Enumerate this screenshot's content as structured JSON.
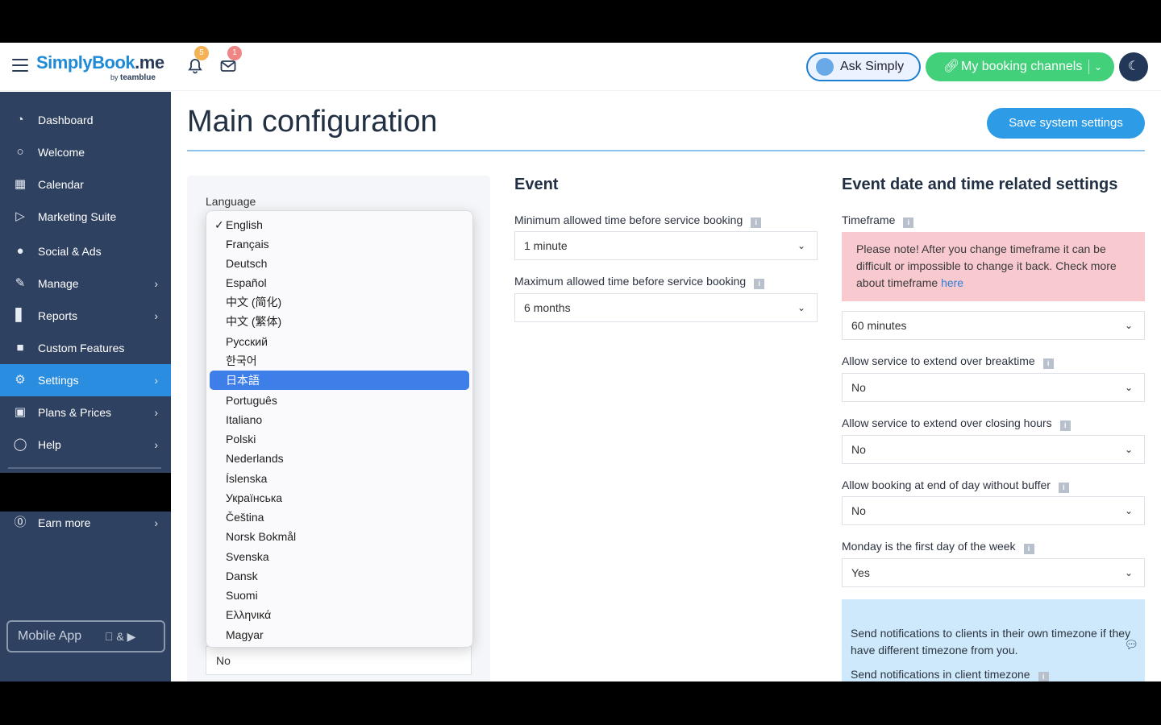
{
  "topbar": {
    "logo_main": "SimplyBook",
    "logo_suffix": ".me",
    "logo_by": "by",
    "logo_brand": "teamblue",
    "notif_count": "5",
    "mail_count": "1",
    "ask_label": "Ask Simply",
    "channels_label": "My booking channels"
  },
  "sidebar": {
    "items": [
      {
        "label": "Dashboard",
        "icon": "gauge-icon"
      },
      {
        "label": "Welcome",
        "icon": "lightbulb-icon"
      },
      {
        "label": "Calendar",
        "icon": "calendar-icon"
      },
      {
        "label": "Marketing Suite",
        "icon": "megaphone-icon"
      },
      {
        "label": "Social & Ads",
        "icon": "social-icon"
      },
      {
        "label": "Manage",
        "icon": "pencil-icon"
      },
      {
        "label": "Reports",
        "icon": "chart-icon"
      },
      {
        "label": "Custom Features",
        "icon": "gift-icon"
      },
      {
        "label": "Settings",
        "icon": "gear-icon"
      },
      {
        "label": "Plans & Prices",
        "icon": "money-icon"
      },
      {
        "label": "Help",
        "icon": "chat-icon"
      },
      {
        "label": "Earn more",
        "icon": "dollar-icon"
      }
    ],
    "mobile_app": "Mobile App",
    "mobile_stores_sep": "&"
  },
  "main": {
    "title": "Main configuration",
    "save_label": "Save system settings",
    "language": {
      "label": "Language",
      "selected": "English",
      "highlighted": "日本語",
      "options": [
        "English",
        "Français",
        "Deutsch",
        "Español",
        "中文 (简化)",
        "中文 (繁体)",
        "Русский",
        "한국어",
        "日本語",
        "Português",
        "Italiano",
        "Polski",
        "Nederlands",
        "Íslenska",
        "Українська",
        "Čeština",
        "Norsk Bokmål",
        "Svenska",
        "Dansk",
        "Suomi",
        "Ελληνικά",
        "Magyar"
      ],
      "behind_value": "No"
    },
    "event": {
      "title": "Event",
      "min_label": "Minimum allowed time before service booking",
      "min_value": "1 minute",
      "max_label": "Maximum allowed time before service booking",
      "max_value": "6 months"
    },
    "datetime": {
      "title": "Event date and time related settings",
      "timeframe_label": "Timeframe",
      "note_text": "Please note! After you change timeframe it can be difficult or impossible to change it back. Check more about timeframe",
      "note_link": "here",
      "timeframe_value": "60 minutes",
      "breaktime_label": "Allow service to extend over breaktime",
      "breaktime_value": "No",
      "closing_label": "Allow service to extend over closing hours",
      "closing_value": "No",
      "buffer_label": "Allow booking at end of day without buffer",
      "buffer_value": "No",
      "monday_label": "Monday is the first day of the week",
      "monday_value": "Yes",
      "tz_note": "Send notifications to clients in their own timezone if they have different timezone from you.",
      "tz_label": "Send notifications in client timezone"
    }
  },
  "colors": {
    "sidebar_bg": "#2f4160",
    "accent_blue": "#2b8de0",
    "green": "#43d07a",
    "pink_note": "#f8c9cf",
    "blue_note": "#cde9fb",
    "menu_highlight": "#3d7ee8"
  }
}
